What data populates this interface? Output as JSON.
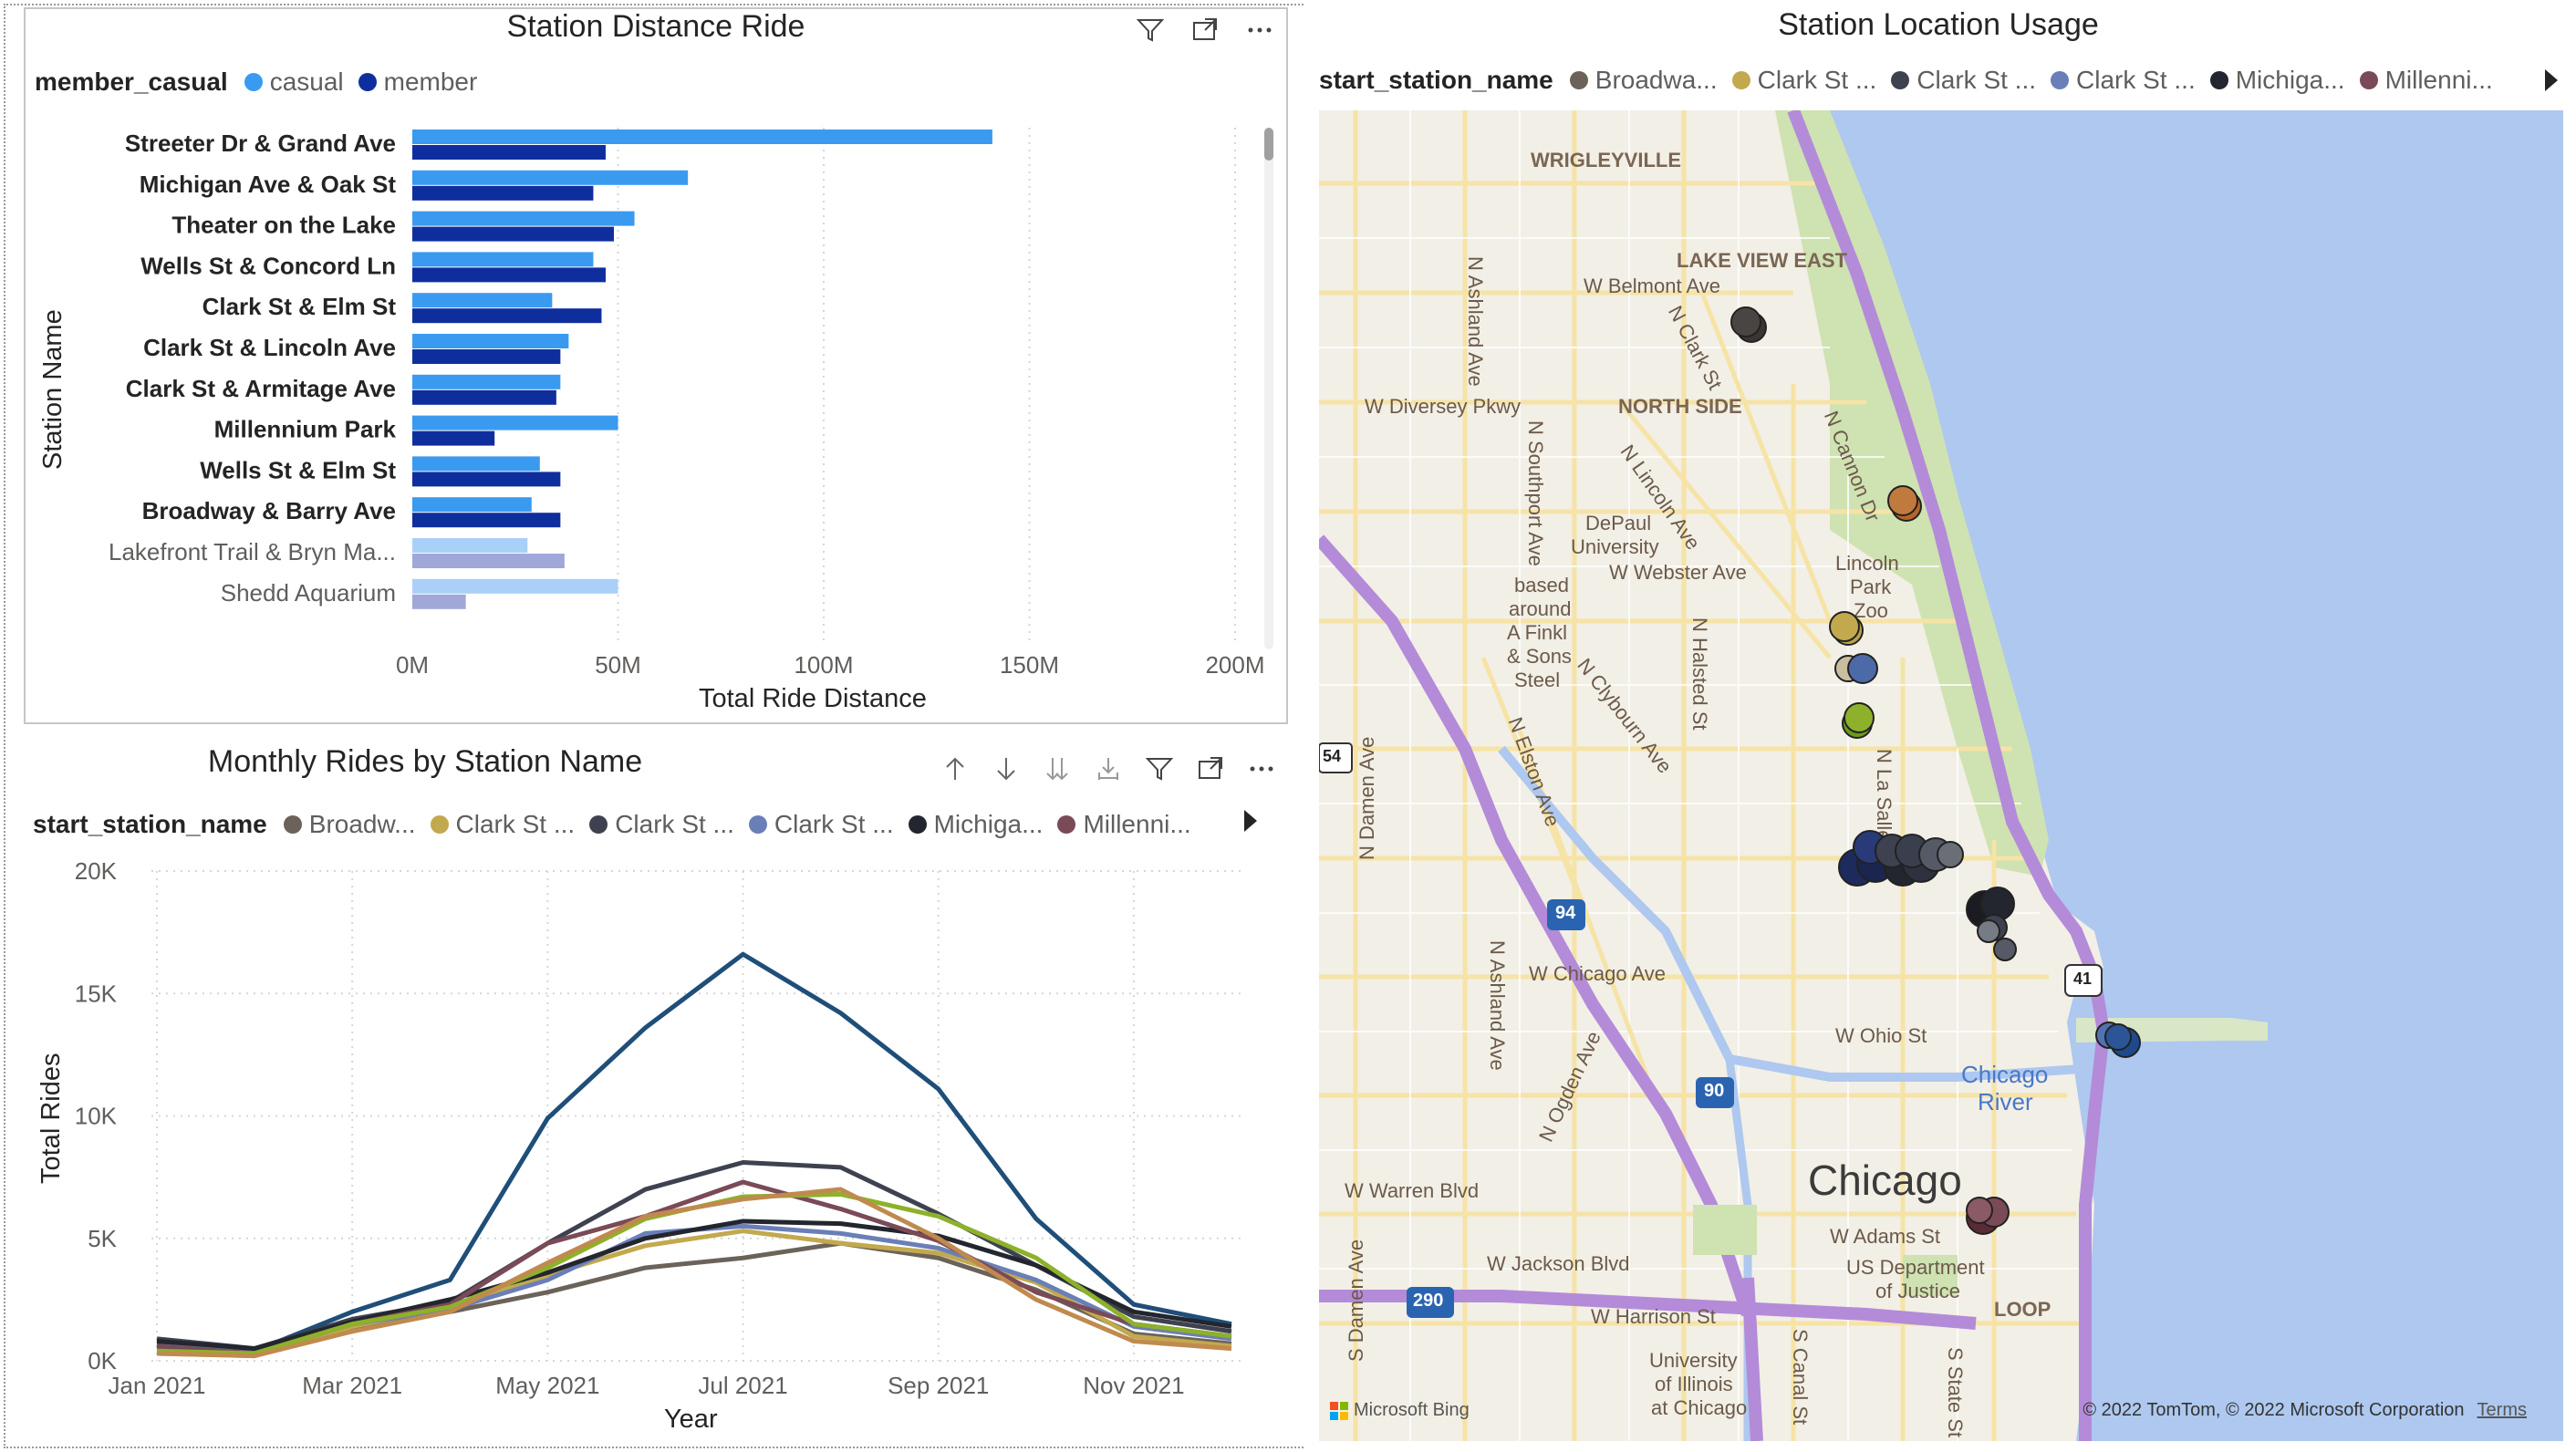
{
  "bar_visual": {
    "title": "Station Distance Ride",
    "legend_title": "member_casual",
    "legend": [
      {
        "label": "casual",
        "color": "#3A9AF0"
      },
      {
        "label": "member",
        "color": "#0F2E9E"
      }
    ],
    "x_axis_title": "Total Ride Distance",
    "y_axis_title": "Station Name"
  },
  "line_visual": {
    "title": "Monthly Rides by Station Name",
    "legend_title": "start_station_name",
    "legend": [
      {
        "label": "Broadw...",
        "color": "#6B625A"
      },
      {
        "label": "Clark St ...",
        "color": "#C2A94E"
      },
      {
        "label": "Clark St ...",
        "color": "#3E4250"
      },
      {
        "label": "Clark St ...",
        "color": "#6A7FB8"
      },
      {
        "label": "Michiga...",
        "color": "#23262E"
      },
      {
        "label": "Millenni...",
        "color": "#7A4A57"
      }
    ],
    "x_axis_title": "Year",
    "y_axis_title": "Total Rides"
  },
  "map_visual": {
    "title": "Station Location Usage",
    "legend_title": "start_station_name",
    "legend": [
      {
        "label": "Broadwa...",
        "color": "#6B625A"
      },
      {
        "label": "Clark St ...",
        "color": "#C2A94E"
      },
      {
        "label": "Clark St ...",
        "color": "#3E4250"
      },
      {
        "label": "Clark St ...",
        "color": "#6A7FB8"
      },
      {
        "label": "Michiga...",
        "color": "#23262E"
      },
      {
        "label": "Millenni...",
        "color": "#7A4A57"
      }
    ],
    "labels": {
      "wrigleyville": "WRIGLEYVILLE",
      "lakeview": "LAKE VIEW EAST",
      "belmont": "W Belmont Ave",
      "clark": "N Clark St",
      "diversey": "W Diversey Pkwy",
      "northside": "NORTH SIDE",
      "ashland1": "N Ashland Ave",
      "southport": "N Southport Ave",
      "lincoln": "N Lincoln Ave",
      "cannon": "N Cannon Dr",
      "depaul1": "DePaul",
      "depaul2": "University",
      "webster": "W Webster Ave",
      "lpz1": "Lincoln",
      "lpz2": "Park",
      "lpz3": "Zoo",
      "finkl1": "based",
      "finkl2": "around",
      "finkl3": "A Finkl",
      "finkl4": "& Sons",
      "finkl5": "Steel",
      "halsted": "N Halsted St",
      "clybourn": "N Clybourn Ave",
      "elston": "N Elston Ave",
      "lasalle": "N La Salle Dr",
      "damen": "N Damen Ave",
      "ashland2": "N Ashland Ave",
      "chicagoave": "W Chicago Ave",
      "ohio": "W Ohio St",
      "ogden": "N Ogden Ave",
      "chicagoriver1": "Chicago",
      "chicagoriver2": "River",
      "chicago": "Chicago",
      "warren": "W Warren Blvd",
      "adams": "W Adams St",
      "usdoj1": "US Department",
      "usdoj2": "of Justice",
      "jackson": "W Jackson Blvd",
      "loop": "LOOP",
      "harrison": "W Harrison St",
      "uic1": "University",
      "uic2": "of Illinois",
      "uic3": "at Chicago",
      "sdamen": "S Damen Ave",
      "canal": "S Canal St",
      "state": "S State St",
      "i94": "94",
      "i90": "90",
      "i290": "290",
      "us41": "41",
      "rt54": "54"
    },
    "bing": "Microsoft Bing",
    "copyright": "© 2022 TomTom, © 2022 Microsoft Corporation",
    "terms": "Terms"
  },
  "chart_data": [
    {
      "type": "bar",
      "title": "Station Distance Ride",
      "orientation": "horizontal",
      "categories": [
        "Streeter Dr & Grand Ave",
        "Michigan Ave & Oak St",
        "Theater on the Lake",
        "Wells St & Concord Ln",
        "Clark St & Elm St",
        "Clark St & Lincoln Ave",
        "Clark St & Armitage Ave",
        "Millennium Park",
        "Wells St & Elm St",
        "Broadway & Barry Ave",
        "Lakefront Trail & Bryn Ma...",
        "Shedd Aquarium"
      ],
      "faded_from_index": 10,
      "series": [
        {
          "name": "casual",
          "values": [
            141,
            67,
            54,
            44,
            34,
            38,
            36,
            50,
            31,
            29,
            28,
            50
          ]
        },
        {
          "name": "member",
          "values": [
            47,
            44,
            49,
            47,
            46,
            36,
            35,
            20,
            36,
            36,
            37,
            13
          ]
        }
      ],
      "unit": "M",
      "xlabel": "Total Ride Distance",
      "ylabel": "Station Name",
      "xlim": [
        0,
        200
      ],
      "xticks": [
        "0M",
        "50M",
        "100M",
        "150M",
        "200M"
      ],
      "grid": true,
      "legend_position": "top-left"
    },
    {
      "type": "line",
      "title": "Monthly Rides by Station Name",
      "x": [
        "Jan 2021",
        "Feb 2021",
        "Mar 2021",
        "Apr 2021",
        "May 2021",
        "Jun 2021",
        "Jul 2021",
        "Aug 2021",
        "Sep 2021",
        "Oct 2021",
        "Nov 2021",
        "Dec 2021"
      ],
      "xticks": [
        "Jan 2021",
        "Mar 2021",
        "May 2021",
        "Jul 2021",
        "Sep 2021",
        "Nov 2021"
      ],
      "series": [
        {
          "color": "#1F4E79",
          "values": [
            700,
            400,
            2000,
            3300,
            9900,
            13600,
            16600,
            14200,
            11100,
            5800,
            2300,
            1500
          ]
        },
        {
          "color": "#6B625A",
          "values": [
            500,
            300,
            1300,
            2000,
            2800,
            3800,
            4200,
            4800,
            4200,
            2900,
            1100,
            700
          ]
        },
        {
          "color": "#C2A94E",
          "values": [
            300,
            200,
            1400,
            2200,
            3500,
            4700,
            5300,
            4800,
            4400,
            3200,
            1000,
            600
          ]
        },
        {
          "color": "#3E4250",
          "values": [
            900,
            500,
            1700,
            2400,
            4800,
            7000,
            8100,
            7900,
            6000,
            3900,
            1800,
            1200
          ]
        },
        {
          "color": "#6A7FB8",
          "values": [
            600,
            400,
            1500,
            2100,
            3300,
            5200,
            5500,
            5200,
            4600,
            3300,
            1400,
            900
          ]
        },
        {
          "color": "#23262E",
          "values": [
            800,
            500,
            1600,
            2500,
            3600,
            5000,
            5700,
            5600,
            5100,
            3900,
            2000,
            1400
          ]
        },
        {
          "color": "#7A4A57",
          "values": [
            600,
            300,
            1500,
            2300,
            4800,
            5900,
            7300,
            6200,
            4900,
            2800,
            1500,
            1000
          ]
        },
        {
          "color": "#8DB12A",
          "values": [
            400,
            300,
            1500,
            2200,
            3800,
            5800,
            6700,
            6800,
            5900,
            4200,
            1500,
            1000
          ]
        },
        {
          "color": "#C08A4F",
          "values": [
            300,
            200,
            1200,
            2000,
            4000,
            5900,
            6600,
            7000,
            5000,
            2500,
            800,
            500
          ]
        }
      ],
      "xlabel": "Year",
      "ylabel": "Total Rides",
      "ylim": [
        0,
        20000
      ],
      "yticks": [
        "0K",
        "5K",
        "10K",
        "15K",
        "20K"
      ],
      "grid": true,
      "legend_position": "top-left"
    }
  ]
}
